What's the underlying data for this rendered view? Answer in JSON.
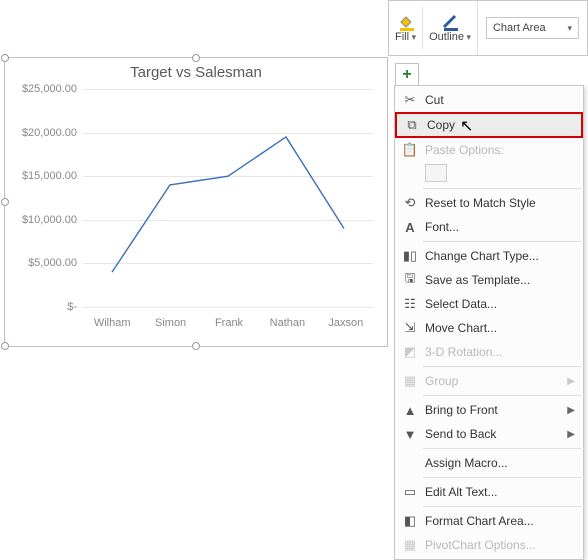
{
  "mini_toolbar": {
    "fill_label": "Fill",
    "outline_label": "Outline",
    "chart_area_label": "Chart Area"
  },
  "chart": {
    "title": "Target vs Salesman",
    "y_ticks": [
      "$25,000.00",
      "$20,000.00",
      "$15,000.00",
      "$10,000.00",
      "$5,000.00",
      "$-"
    ],
    "x_ticks": [
      "Wilham",
      "Simon",
      "Frank",
      "Nathan",
      "Jaxson"
    ]
  },
  "chart_data": {
    "type": "line",
    "title": "Target vs Salesman",
    "categories": [
      "Wilham",
      "Simon",
      "Frank",
      "Nathan",
      "Jaxson"
    ],
    "values": [
      4000,
      14000,
      15000,
      19500,
      9000
    ],
    "xlabel": "",
    "ylabel": "",
    "ylim": [
      0,
      25000
    ],
    "y_tick_format": "$#,##0.00",
    "series_color": "#3b6fb6"
  },
  "context_menu": {
    "cut": "Cut",
    "copy": "Copy",
    "paste_options": "Paste Options:",
    "reset": "Reset to Match Style",
    "font": "Font...",
    "change_type": "Change Chart Type...",
    "save_template": "Save as Template...",
    "select_data": "Select Data...",
    "move_chart": "Move Chart...",
    "rotation": "3-D Rotation...",
    "group": "Group",
    "bring_front": "Bring to Front",
    "send_back": "Send to Back",
    "assign_macro": "Assign Macro...",
    "edit_alt": "Edit Alt Text...",
    "format_area": "Format Chart Area...",
    "pivot_options": "PivotChart Options..."
  }
}
